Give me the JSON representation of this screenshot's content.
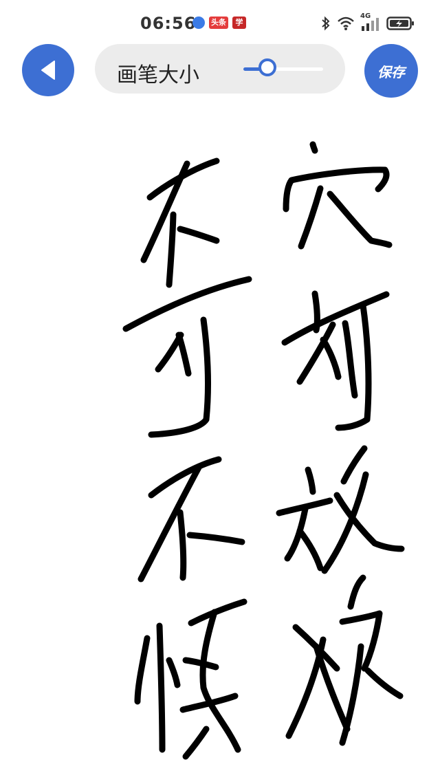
{
  "status_bar": {
    "time": "06:56",
    "badge_toutiao": "头条",
    "badge_xuexi": "学习",
    "network": "4G"
  },
  "toolbar": {
    "back_icon": "back-arrow-icon",
    "brush_size_label": "画笔大小",
    "brush_size_level": 0.3,
    "save_label": "保存"
  },
  "colors": {
    "accent": "#3d6fd3",
    "pill_bg": "#ececec",
    "ink": "#000000"
  }
}
